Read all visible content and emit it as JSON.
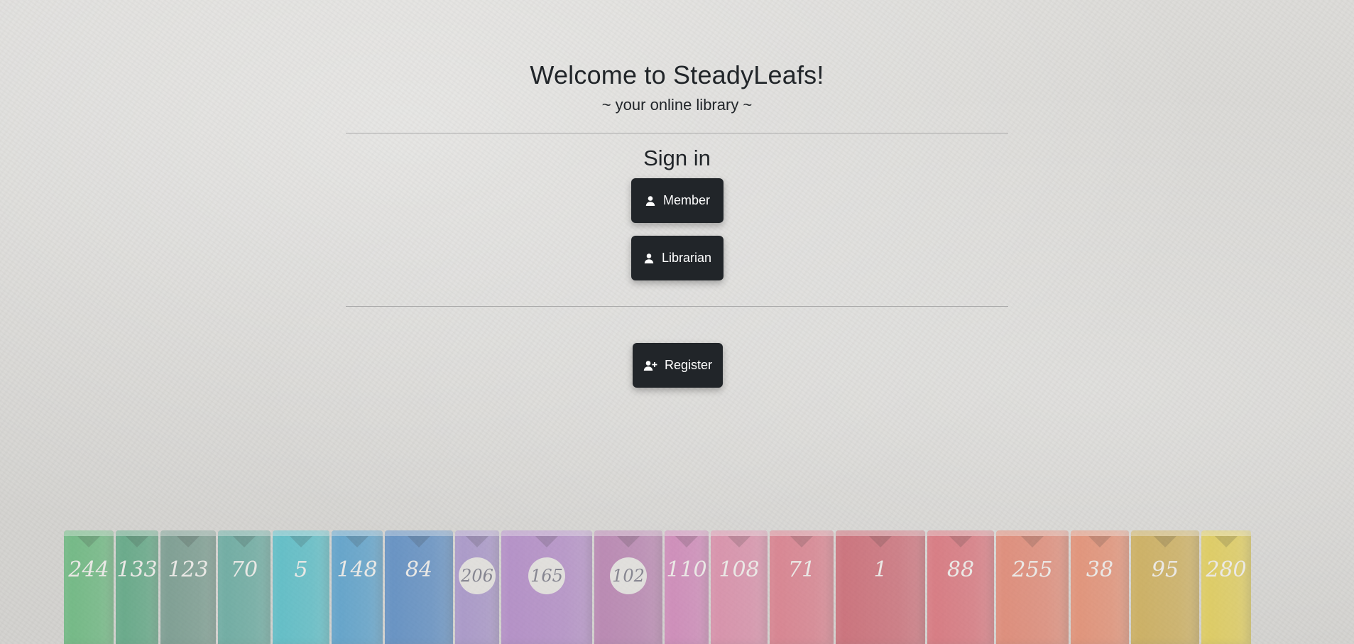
{
  "header": {
    "title": "Welcome to SteadyLeafs!",
    "subtitle": "~ your online library ~"
  },
  "signin": {
    "heading": "Sign in",
    "member_label": "Member",
    "librarian_label": "Librarian"
  },
  "register": {
    "label": "Register"
  },
  "background": {
    "book_numbers": [
      "244",
      "133",
      "123",
      "70",
      "5",
      "148",
      "84",
      "206",
      "165",
      "102",
      "110",
      "108",
      "71",
      "1",
      "88",
      "255",
      "38",
      "95",
      "280"
    ],
    "book_colors": [
      "#4fb06a",
      "#3f9a6f",
      "#5f8c7d",
      "#4c9f93",
      "#39b7c4",
      "#3b93c9",
      "#3f7bbf",
      "#9b84c6",
      "#a979c4",
      "#b06ea8",
      "#cc73b1",
      "#d97b9e",
      "#d9687a",
      "#c8505e",
      "#d85b66",
      "#e1745c",
      "#e57c5a",
      "#c9a33c",
      "#e1c93b"
    ]
  },
  "colors": {
    "button_bg": "#212529",
    "text": "#212529"
  },
  "icons": {
    "member": "person-icon",
    "librarian": "person-icon",
    "register": "person-plus-icon"
  }
}
